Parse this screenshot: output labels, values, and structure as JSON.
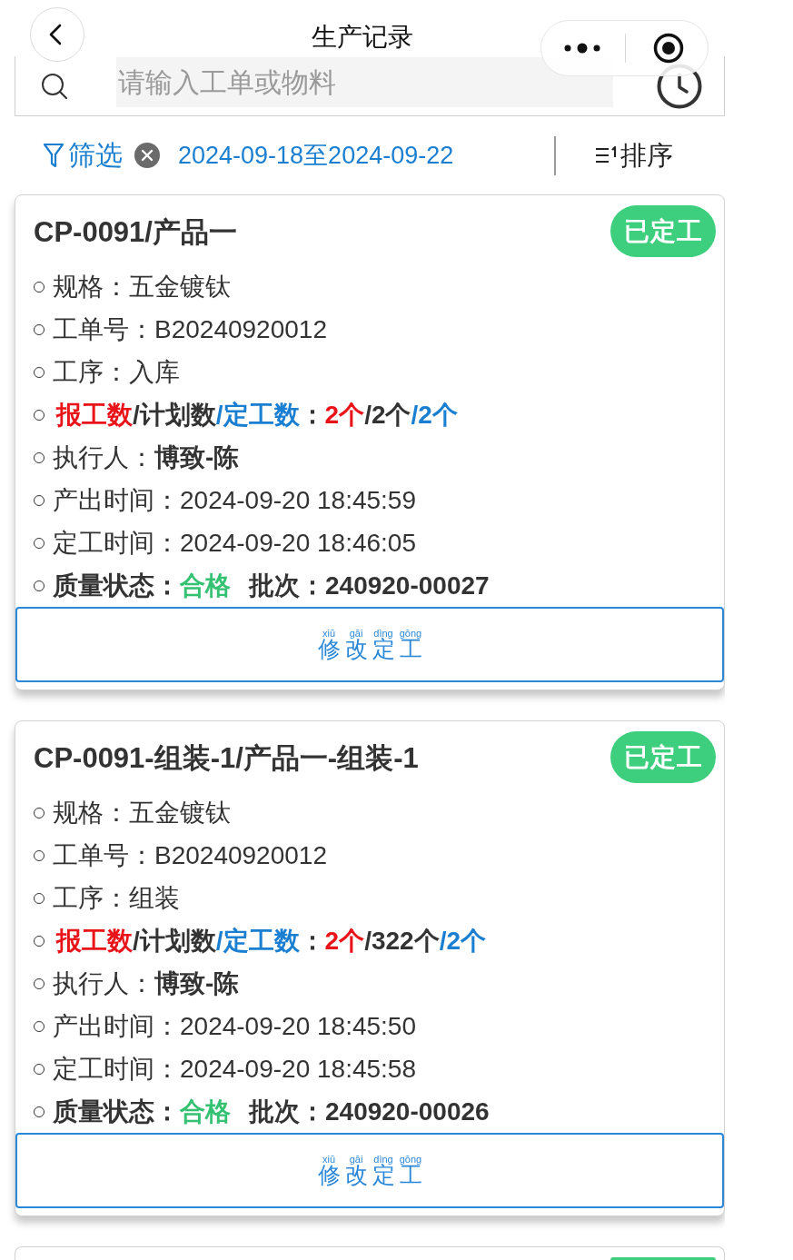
{
  "nav": {
    "title": "生产记录"
  },
  "search": {
    "placeholder": "请输入工单或物料"
  },
  "filter": {
    "label": "筛选",
    "date_range": "2024-09-18至2024-09-22",
    "sort_label": "排序"
  },
  "cards": [
    {
      "title": "CP-0091/产品一",
      "status": {
        "label": "已定工",
        "kind": "fixed"
      },
      "fields": [
        {
          "kind": "plain",
          "label": "规格：",
          "value": "五金镀钛"
        },
        {
          "kind": "plain",
          "label": "工单号：",
          "value": "B20240920012"
        },
        {
          "kind": "plain",
          "label": "工序：",
          "value": "入库"
        },
        {
          "kind": "counts",
          "segments": [
            {
              "text": "报工数",
              "kind": "reported"
            },
            {
              "text": "/计划数",
              "kind": "planned"
            },
            {
              "text": "/定工数",
              "kind": "fixed"
            },
            {
              "text": "：",
              "kind": "planned"
            },
            {
              "text": "2个",
              "kind": "reported"
            },
            {
              "text": "/2个",
              "kind": "planned"
            },
            {
              "text": "/2个",
              "kind": "fixed"
            }
          ]
        },
        {
          "kind": "person",
          "label": "执行人：",
          "value": "博致-陈"
        },
        {
          "kind": "plain",
          "label": "产出时间：",
          "value": "2024-09-20 18:45:59"
        },
        {
          "kind": "plain",
          "label": "定工时间：",
          "value": "2024-09-20 18:46:05"
        },
        {
          "kind": "quality",
          "label": "质量状态：",
          "value": "合格",
          "batch_label": "批次：",
          "batch": "240920-00027"
        }
      ],
      "action": {
        "chars": [
          {
            "char": "修",
            "pinyin": "xiū"
          },
          {
            "char": "改",
            "pinyin": "gāi"
          },
          {
            "char": "定",
            "pinyin": "dìng"
          },
          {
            "char": "工",
            "pinyin": "gōng"
          }
        ]
      }
    },
    {
      "title": "CP-0091-组装-1/产品一-组装-1",
      "status": {
        "label": "已定工",
        "kind": "fixed"
      },
      "fields": [
        {
          "kind": "plain",
          "label": "规格：",
          "value": "五金镀钛"
        },
        {
          "kind": "plain",
          "label": "工单号：",
          "value": "B20240920012"
        },
        {
          "kind": "plain",
          "label": "工序：",
          "value": "组装"
        },
        {
          "kind": "counts",
          "segments": [
            {
              "text": "报工数",
              "kind": "reported"
            },
            {
              "text": "/计划数",
              "kind": "planned"
            },
            {
              "text": "/定工数",
              "kind": "fixed"
            },
            {
              "text": "：",
              "kind": "planned"
            },
            {
              "text": "2个",
              "kind": "reported"
            },
            {
              "text": "/322个",
              "kind": "planned"
            },
            {
              "text": "/2个",
              "kind": "fixed"
            }
          ]
        },
        {
          "kind": "person",
          "label": "执行人：",
          "value": "博致-陈"
        },
        {
          "kind": "plain",
          "label": "产出时间：",
          "value": "2024-09-20 18:45:50"
        },
        {
          "kind": "plain",
          "label": "定工时间：",
          "value": "2024-09-20 18:45:58"
        },
        {
          "kind": "quality",
          "label": "质量状态：",
          "value": "合格",
          "batch_label": "批次：",
          "batch": "240920-00026"
        }
      ],
      "action": {
        "chars": [
          {
            "char": "修",
            "pinyin": "xiū"
          },
          {
            "char": "改",
            "pinyin": "gāi"
          },
          {
            "char": "定",
            "pinyin": "dìng"
          },
          {
            "char": "工",
            "pinyin": "gōng"
          }
        ]
      }
    },
    {
      "status": {
        "kind": "fixed"
      }
    }
  ]
}
